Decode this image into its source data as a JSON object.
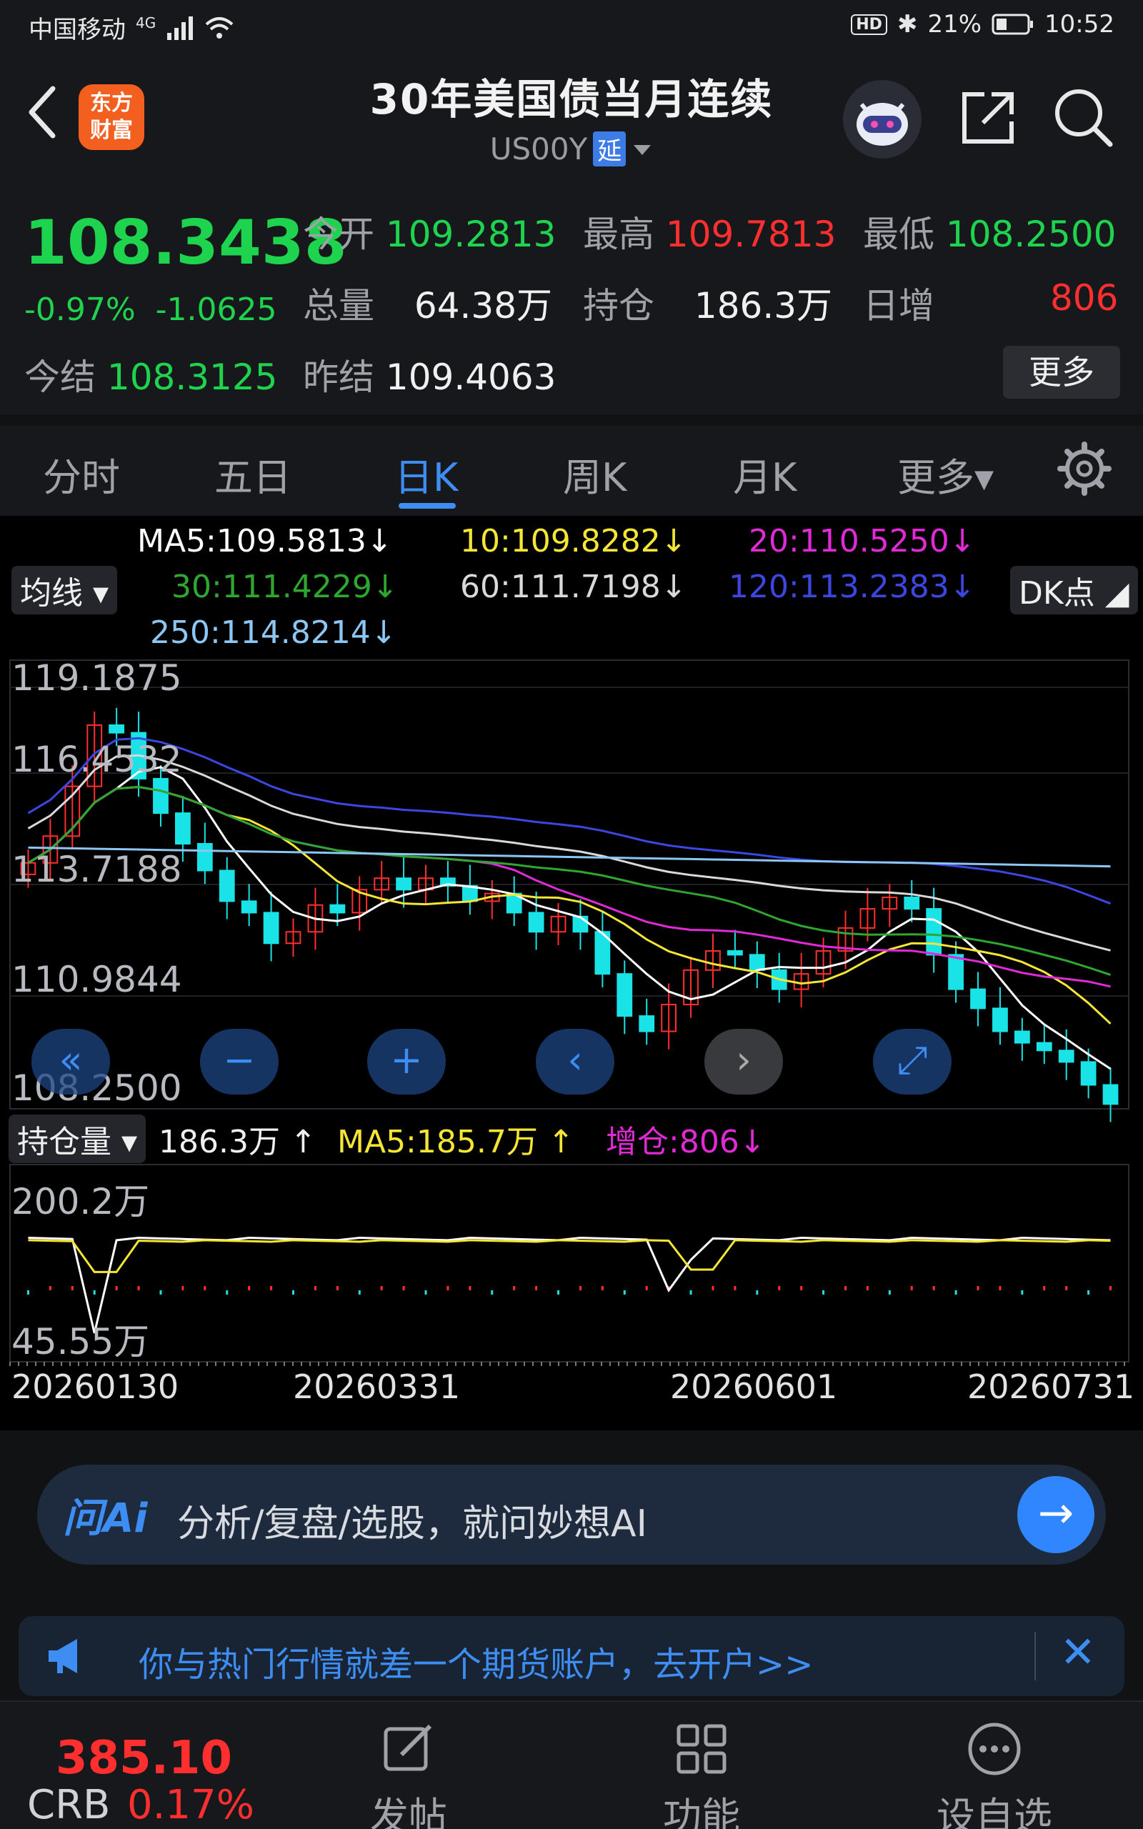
{
  "status": {
    "carrier": "中国移动",
    "net": "4G",
    "battery": "21%",
    "time": "10:52",
    "hd": "HD"
  },
  "header": {
    "title": "30年美国债当月连续",
    "code": "US00Y",
    "delay": "延",
    "logo_line1": "东方",
    "logo_line2": "财富"
  },
  "quote": {
    "price": "108.3438",
    "pct": "-0.97%",
    "change": "-1.0625",
    "open_label": "今开",
    "open": "109.2813",
    "high_label": "最高",
    "high": "109.7813",
    "low_label": "最低",
    "low": "108.2500",
    "volume_label": "总量",
    "volume": "64.38万",
    "oi_label": "持仓",
    "oi": "186.3万",
    "daily_inc_label": "日增",
    "daily_inc": "806",
    "settle_label": "今结",
    "settle": "108.3125",
    "prev_settle_label": "昨结",
    "prev_settle": "109.4063",
    "more": "更多"
  },
  "tabs": [
    "分时",
    "五日",
    "日K",
    "周K",
    "月K",
    "更多▾"
  ],
  "indicators": {
    "ma_select": "均线 ▾",
    "ma5": "MA5:109.5813↓",
    "ma10": "10:109.8282↓",
    "ma20": "20:110.5250↓",
    "ma30": "30:111.4229↓",
    "ma60": "60:111.7198↓",
    "ma120": "120:113.2383↓",
    "ma250": "250:114.8214↓",
    "dk": "DK点 ◢"
  },
  "colors": {
    "ma5": "#ffffff",
    "ma10": "#f5e636",
    "ma20": "#e02ad6",
    "ma30": "#2fa630",
    "ma60": "#d9d9d9",
    "ma120": "#3c46e0",
    "ma250": "#8cc6f2",
    "up": "#ff2f2f",
    "down": "#19e3e6"
  },
  "price_ticks": [
    "119.1875",
    "116.4532",
    "113.7188",
    "110.9844",
    "108.2500"
  ],
  "controls": {
    "first": "«",
    "zoom_out": "−",
    "zoom_in": "+",
    "prev": "‹",
    "next": "›",
    "fullscreen": "⤢"
  },
  "oi_panel": {
    "select": "持仓量 ▾",
    "value": "186.3万 ↑",
    "ma5": "MA5:185.7万 ↑",
    "inc": "增仓:806↓",
    "tick_high": "200.2万",
    "tick_low": "45.55万"
  },
  "dates": [
    "20260130",
    "20260331",
    "20260601",
    "20260731"
  ],
  "chart_data": {
    "type": "candlestick",
    "ylim": [
      108.25,
      119.1875
    ],
    "dates": [
      "20260130",
      "20260331",
      "20260601",
      "20260731"
    ],
    "closes": [
      114.6,
      115.3,
      116.6,
      118.2,
      118.0,
      116.8,
      115.9,
      115.1,
      114.4,
      113.6,
      113.3,
      112.5,
      112.8,
      113.5,
      113.3,
      113.9,
      114.2,
      113.9,
      114.2,
      114.0,
      113.6,
      113.8,
      113.3,
      112.8,
      113.2,
      112.8,
      111.7,
      110.6,
      110.2,
      110.9,
      111.8,
      112.3,
      112.2,
      111.8,
      111.3,
      111.7,
      112.3,
      112.9,
      113.4,
      113.7,
      113.4,
      112.2,
      111.3,
      110.8,
      110.2,
      109.9,
      109.7,
      109.4,
      108.8,
      108.3
    ],
    "ma_latest": {
      "MA5": 109.5813,
      "MA10": 109.8282,
      "MA20": 110.525,
      "MA30": 111.4229,
      "MA60": 111.7198,
      "MA120": 113.2383,
      "MA250": 114.8214
    },
    "open_interest": {
      "latest": "186.3万",
      "ma5": "185.7万",
      "increase": 806,
      "ylim": [
        "45.55万",
        "200.2万"
      ]
    }
  },
  "ai": {
    "logo": "问Ai",
    "text": "分析/复盘/选股，就问妙想AI",
    "go": "→"
  },
  "banner": {
    "text": "你与热门行情就差一个期货账户，去开户>>",
    "close": "✕"
  },
  "bottom": {
    "crb_price": "385.10",
    "crb_name": "CRB",
    "crb_pct": "0.17%",
    "post": "发帖",
    "func": "功能",
    "custom": "设自选"
  }
}
